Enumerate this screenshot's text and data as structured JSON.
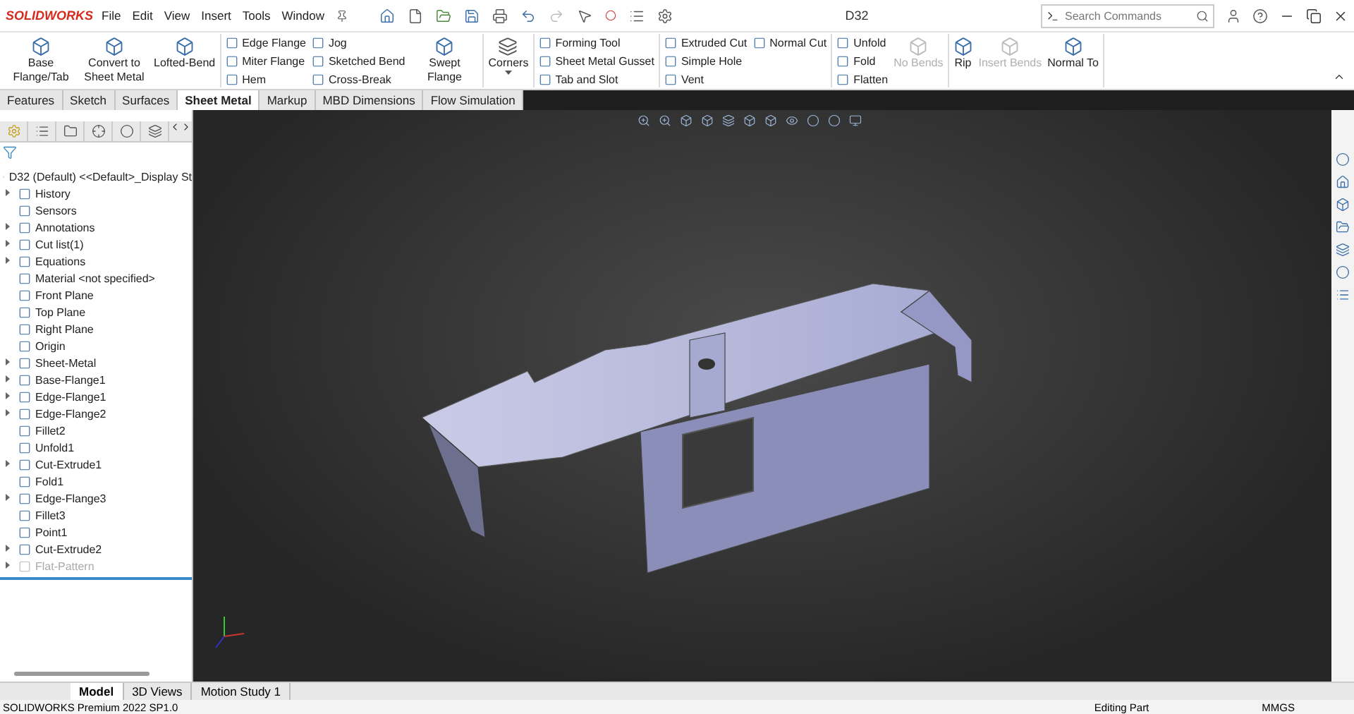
{
  "app": {
    "logo": "SOLIDWORKS",
    "menus": [
      "File",
      "Edit",
      "View",
      "Insert",
      "Tools",
      "Window"
    ],
    "title": "D32",
    "search": {
      "placeholder": "Search Commands"
    }
  },
  "ribbon": [
    [
      {
        "kind": "large",
        "label": "Base Flange/Tab",
        "disabled": false
      },
      {
        "kind": "large",
        "label": "Convert to Sheet Metal",
        "disabled": false
      },
      {
        "kind": "large",
        "label": "Lofted-Bend",
        "disabled": false
      }
    ],
    [
      {
        "kind": "stack",
        "items": [
          {
            "label": "Edge Flange",
            "disabled": false
          },
          {
            "label": "Miter Flange",
            "disabled": false
          },
          {
            "label": "Hem",
            "disabled": false
          }
        ]
      },
      {
        "kind": "stack",
        "items": [
          {
            "label": "Jog",
            "disabled": false
          },
          {
            "label": "Sketched Bend",
            "disabled": false
          },
          {
            "label": "Cross-Break",
            "disabled": false
          }
        ]
      },
      {
        "kind": "large",
        "label": "Swept Flange",
        "disabled": false
      }
    ],
    [
      {
        "kind": "dropdown",
        "label": "Corners",
        "disabled": false
      }
    ],
    [
      {
        "kind": "stack",
        "items": [
          {
            "label": "Forming Tool",
            "disabled": false
          },
          {
            "label": "Sheet Metal Gusset",
            "disabled": false
          },
          {
            "label": "Tab and Slot",
            "disabled": false
          }
        ]
      }
    ],
    [
      {
        "kind": "stack",
        "items": [
          {
            "label": "Extruded Cut",
            "disabled": false
          },
          {
            "label": "Simple Hole",
            "disabled": false
          },
          {
            "label": "Vent",
            "disabled": false
          }
        ]
      },
      {
        "kind": "stack",
        "items": [
          {
            "label": "Normal Cut",
            "disabled": false
          }
        ]
      }
    ],
    [
      {
        "kind": "stack",
        "items": [
          {
            "label": "Unfold",
            "disabled": false
          },
          {
            "label": "Fold",
            "disabled": false
          },
          {
            "label": "Flatten",
            "disabled": false
          }
        ]
      },
      {
        "kind": "large",
        "label": "No Bends",
        "disabled": true
      }
    ],
    [
      {
        "kind": "large",
        "label": "Rip",
        "disabled": false
      },
      {
        "kind": "large",
        "label": "Insert Bends",
        "disabled": true
      },
      {
        "kind": "large",
        "label": "Normal To",
        "disabled": false
      }
    ]
  ],
  "tabs": [
    {
      "label": "Features",
      "selected": false
    },
    {
      "label": "Sketch",
      "selected": false
    },
    {
      "label": "Surfaces",
      "selected": false
    },
    {
      "label": "Sheet Metal",
      "selected": true
    },
    {
      "label": "Markup",
      "selected": false
    },
    {
      "label": "MBD Dimensions",
      "selected": false
    },
    {
      "label": "Flow Simulation",
      "selected": false
    }
  ],
  "tree": {
    "root": "D32 (Default) <<Default>_Display St",
    "items": [
      {
        "label": "History",
        "collapsible": true,
        "suppressed": false
      },
      {
        "label": "Sensors",
        "collapsible": false,
        "suppressed": false
      },
      {
        "label": "Annotations",
        "collapsible": true,
        "suppressed": false
      },
      {
        "label": "Cut list(1)",
        "collapsible": true,
        "suppressed": false
      },
      {
        "label": "Equations",
        "collapsible": true,
        "suppressed": false
      },
      {
        "label": "Material <not specified>",
        "collapsible": false,
        "suppressed": false
      },
      {
        "label": "Front Plane",
        "collapsible": false,
        "suppressed": false
      },
      {
        "label": "Top Plane",
        "collapsible": false,
        "suppressed": false
      },
      {
        "label": "Right Plane",
        "collapsible": false,
        "suppressed": false
      },
      {
        "label": "Origin",
        "collapsible": false,
        "suppressed": false
      },
      {
        "label": "Sheet-Metal",
        "collapsible": true,
        "suppressed": false
      },
      {
        "label": "Base-Flange1",
        "collapsible": true,
        "suppressed": false
      },
      {
        "label": "Edge-Flange1",
        "collapsible": true,
        "suppressed": false
      },
      {
        "label": "Edge-Flange2",
        "collapsible": true,
        "suppressed": false
      },
      {
        "label": "Fillet2",
        "collapsible": false,
        "suppressed": false
      },
      {
        "label": "Unfold1",
        "collapsible": false,
        "suppressed": false
      },
      {
        "label": "Cut-Extrude1",
        "collapsible": true,
        "suppressed": false
      },
      {
        "label": "Fold1",
        "collapsible": false,
        "suppressed": false
      },
      {
        "label": "Edge-Flange3",
        "collapsible": true,
        "suppressed": false
      },
      {
        "label": "Fillet3",
        "collapsible": false,
        "suppressed": false
      },
      {
        "label": "Point1",
        "collapsible": false,
        "suppressed": false
      },
      {
        "label": "Cut-Extrude2",
        "collapsible": true,
        "suppressed": false
      },
      {
        "label": "Flat-Pattern",
        "collapsible": true,
        "suppressed": true
      }
    ]
  },
  "bottom_tabs": [
    {
      "label": "Model",
      "selected": true
    },
    {
      "label": "3D Views",
      "selected": false
    },
    {
      "label": "Motion Study 1",
      "selected": false
    }
  ],
  "status_bar": {
    "product": "SOLIDWORKS Premium 2022 SP1.0",
    "mode": "Editing Part",
    "units": "MMGS"
  }
}
